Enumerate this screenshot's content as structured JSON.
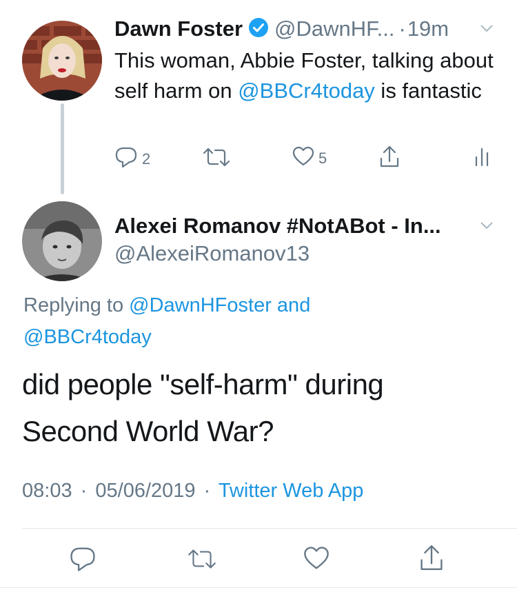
{
  "quoted_tweet": {
    "display_name": "Dawn Foster",
    "handle": "@DawnHF...",
    "separator": "·",
    "time": "19m",
    "text_before": "This woman, Abbie Foster, talking about self harm on ",
    "mention": "@BBCr4today",
    "text_after": " is fantastic",
    "reply_count": "2",
    "retweet_count": "",
    "like_count": "5"
  },
  "main_tweet": {
    "display_name": "Alexei Romanov #NotABot - In...",
    "handle": "@AlexeiRomanov13",
    "replying_prefix": "Replying to ",
    "replying_user1": "@DawnHFoster",
    "replying_and": " and",
    "replying_user2": "@BBCr4today",
    "text_line1": "did people \"self-harm\" during",
    "text_line2": "Second World War?",
    "time": "08:03",
    "date": "05/06/2019",
    "dot": "·",
    "source": "Twitter Web App"
  },
  "icons": {
    "reply": "reply-icon",
    "retweet": "retweet-icon",
    "like": "heart-icon",
    "share": "share-icon",
    "analytics": "analytics-icon",
    "chevron": "chevron-down-icon",
    "verified": "verified-badge-icon"
  },
  "colors": {
    "link": "#1b95e0",
    "secondary": "#657786",
    "primary_text": "#14171a",
    "thread_line": "#c8d0d7"
  }
}
